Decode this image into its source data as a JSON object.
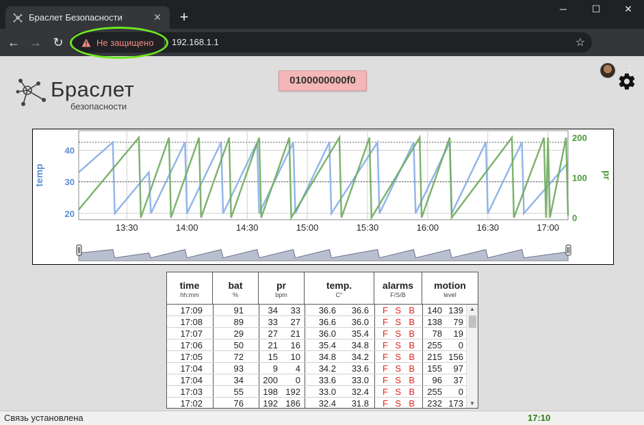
{
  "browser": {
    "tab_title": "Браслет Безопасности",
    "tab_close": "✕",
    "new_tab": "+",
    "security_label": "Не защищено",
    "url": "192.168.1.1",
    "win_minimize": "─",
    "win_maximize": "☐",
    "win_close": "✕"
  },
  "page": {
    "logo_main": "Браслет",
    "logo_sub": "безопасности",
    "device_id": "0100000000f0"
  },
  "chart_data": {
    "type": "line",
    "x_ticks": [
      "13:30",
      "14:00",
      "14:30",
      "15:00",
      "15:30",
      "16:00",
      "16:30",
      "17:00"
    ],
    "y_left": {
      "label": "temp",
      "ticks": [
        "20",
        "30",
        "40"
      ],
      "range": [
        18,
        44
      ],
      "color": "#5b8fd6"
    },
    "y_right": {
      "label": "pr",
      "ticks": [
        "0",
        "100",
        "200"
      ],
      "range": [
        0,
        200
      ],
      "color": "#4e9a3a"
    },
    "reference_lines_left": [
      42.5,
      30
    ],
    "series": [
      {
        "axis": "left",
        "color": "#86aee6",
        "x": [
          "13:06",
          "13:23",
          "13:24",
          "13:41",
          "13:42",
          "13:59",
          "14:00",
          "14:17",
          "14:18",
          "14:35",
          "14:36",
          "14:53",
          "14:54",
          "15:11",
          "15:12",
          "15:35",
          "15:36",
          "15:53",
          "15:54",
          "16:11",
          "16:12",
          "16:29",
          "16:30",
          "16:47",
          "16:48",
          "17:10"
        ],
        "y": [
          33,
          42.5,
          20,
          33,
          20,
          42.5,
          20,
          42.5,
          20,
          42.5,
          20,
          42.5,
          20,
          42.5,
          20,
          42.5,
          20,
          42.5,
          20,
          42.5,
          20,
          42.5,
          20,
          42.5,
          20,
          36
        ]
      },
      {
        "axis": "right",
        "color": "#6fab5e",
        "x": [
          "13:06",
          "13:36",
          "13:37",
          "13:51",
          "13:52",
          "14:06",
          "14:07",
          "14:21",
          "14:22",
          "14:36",
          "14:37",
          "14:51",
          "14:52",
          "15:16",
          "15:17",
          "15:31",
          "15:32",
          "15:56",
          "15:57",
          "16:11",
          "16:12",
          "16:42",
          "16:43",
          "16:58",
          "16:59",
          "17:00",
          "17:01",
          "17:09",
          "17:10"
        ],
        "y": [
          20,
          200,
          0,
          200,
          0,
          200,
          0,
          200,
          0,
          200,
          0,
          200,
          0,
          200,
          0,
          200,
          0,
          200,
          0,
          200,
          0,
          200,
          0,
          200,
          0,
          200,
          0,
          200,
          5
        ]
      }
    ]
  },
  "table": {
    "columns": [
      {
        "title": "time",
        "unit": "hh:mm"
      },
      {
        "title": "bat",
        "unit": "%"
      },
      {
        "title": "pr",
        "unit": "bpm"
      },
      {
        "title": "temp.",
        "unit": "C°"
      },
      {
        "title": "alarms",
        "unit": "F/S/B"
      },
      {
        "title": "motion",
        "unit": "level"
      }
    ],
    "rows": [
      {
        "time": "17:09",
        "bat": "91",
        "pr1": "34",
        "pr2": "33",
        "t1": "36.6",
        "t2": "36.6",
        "a1": "F",
        "a2": "S",
        "a3": "B",
        "m1": "140",
        "m2": "139"
      },
      {
        "time": "17:08",
        "bat": "89",
        "pr1": "33",
        "pr2": "27",
        "t1": "36.6",
        "t2": "36.0",
        "a1": "F",
        "a2": "S",
        "a3": "B",
        "m1": "138",
        "m2": "79"
      },
      {
        "time": "17:07",
        "bat": "29",
        "pr1": "27",
        "pr2": "21",
        "t1": "36.0",
        "t2": "35.4",
        "a1": "F",
        "a2": "S",
        "a3": "B",
        "m1": "78",
        "m2": "19"
      },
      {
        "time": "17:06",
        "bat": "50",
        "pr1": "21",
        "pr2": "16",
        "t1": "35.4",
        "t2": "34.8",
        "a1": "F",
        "a2": "S",
        "a3": "B",
        "m1": "255",
        "m2": "0"
      },
      {
        "time": "17:05",
        "bat": "72",
        "pr1": "15",
        "pr2": "10",
        "t1": "34.8",
        "t2": "34.2",
        "a1": "F",
        "a2": "S",
        "a3": "B",
        "m1": "215",
        "m2": "156"
      },
      {
        "time": "17:04",
        "bat": "93",
        "pr1": "9",
        "pr2": "4",
        "t1": "34.2",
        "t2": "33.6",
        "a1": "F",
        "a2": "S",
        "a3": "B",
        "m1": "155",
        "m2": "97"
      },
      {
        "time": "17:04",
        "bat": "34",
        "pr1": "200",
        "pr2": "0",
        "t1": "33.6",
        "t2": "33.0",
        "a1": "F",
        "a2": "S",
        "a3": "B",
        "m1": "96",
        "m2": "37"
      },
      {
        "time": "17:03",
        "bat": "55",
        "pr1": "198",
        "pr2": "192",
        "t1": "33.0",
        "t2": "32.4",
        "a1": "F",
        "a2": "S",
        "a3": "B",
        "m1": "255",
        "m2": "0"
      },
      {
        "time": "17:02",
        "bat": "76",
        "pr1": "192",
        "pr2": "186",
        "t1": "32.4",
        "t2": "31.8",
        "a1": "F",
        "a2": "S",
        "a3": "B",
        "m1": "232",
        "m2": "173"
      }
    ],
    "alarm_color": "#d9271a"
  },
  "status": {
    "text": "Связь установлена",
    "time": "17:10",
    "time_color": "#2e7d12"
  }
}
